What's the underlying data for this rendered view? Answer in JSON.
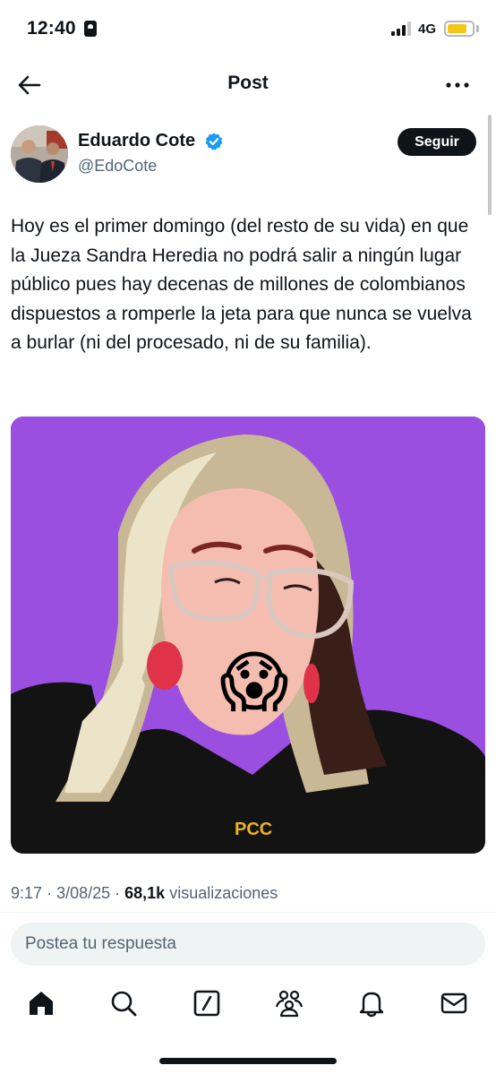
{
  "status_bar": {
    "time": "12:40",
    "network": "4G",
    "battery_level": 0.7,
    "icons": [
      "id-card-icon",
      "signal-icon",
      "battery-icon"
    ]
  },
  "header": {
    "title": "Post",
    "back_icon": "arrow-left-icon",
    "more_icon": "ellipsis-icon"
  },
  "author": {
    "name": "Eduardo Cote",
    "handle": "@EdoCote",
    "verified": true,
    "follow_label": "Seguir"
  },
  "post": {
    "text": "Hoy es el primer domingo (del resto de su vida) en que la Jueza Sandra Heredia no podrá salir a ningún lugar público pues hay decenas de millones de colombianos dispuestos a romperle la jeta para que nunca se vuelva a burlar (ni del procesado, ni de su familia).",
    "media": {
      "emoji": "😱",
      "watermark": "PCC",
      "background_color": "#9a4fe0"
    }
  },
  "meta": {
    "time": "9:17",
    "date": "3/08/25",
    "views_count": "68,1k",
    "views_label": "visualizaciones"
  },
  "reply": {
    "placeholder": "Postea tu respuesta"
  },
  "tab_bar": {
    "items": [
      "home-icon",
      "search-icon",
      "grok-icon",
      "communities-icon",
      "notifications-icon",
      "messages-icon"
    ]
  },
  "colors": {
    "text": "#0f1419",
    "secondary": "#536471",
    "verified": "#1d9bf0",
    "reply_bg": "#eff3f4"
  }
}
